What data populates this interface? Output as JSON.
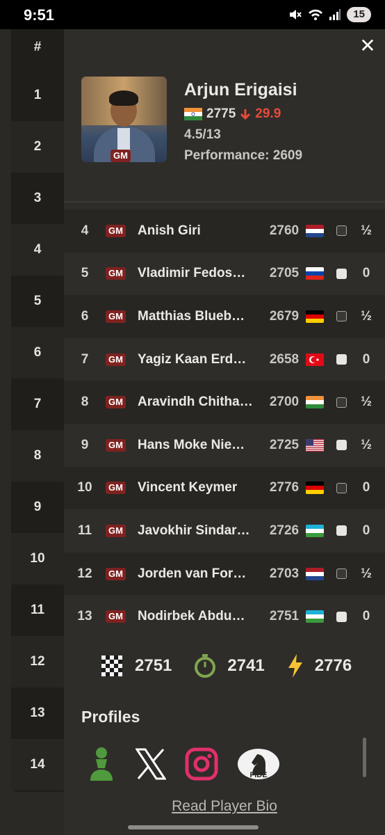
{
  "status_bar": {
    "time": "9:51",
    "battery": "15"
  },
  "rank_column": {
    "header": "#",
    "ranks": [
      "1",
      "2",
      "3",
      "4",
      "5",
      "6",
      "7",
      "8",
      "9",
      "10",
      "11",
      "12",
      "13",
      "14"
    ]
  },
  "player": {
    "name": "Arjun Erigaisi",
    "title": "GM",
    "flag": "india",
    "rating": "2775",
    "rating_change": "29.9",
    "score": "4.5/13",
    "performance": "Performance: 2609"
  },
  "games": [
    {
      "no": "4",
      "title": "GM",
      "name": "Anish Giri",
      "rating": "2760",
      "flag": "netherlands",
      "color": "black",
      "result": "½"
    },
    {
      "no": "5",
      "title": "GM",
      "name": "Vladimir Fedos…",
      "rating": "2705",
      "flag": "slovenia",
      "color": "white",
      "result": "0"
    },
    {
      "no": "6",
      "title": "GM",
      "name": "Matthias Blueb…",
      "rating": "2679",
      "flag": "germany",
      "color": "black",
      "result": "½"
    },
    {
      "no": "7",
      "title": "GM",
      "name": "Yagiz Kaan Erd…",
      "rating": "2658",
      "flag": "turkey",
      "color": "white",
      "result": "0"
    },
    {
      "no": "8",
      "title": "GM",
      "name": "Aravindh Chitha…",
      "rating": "2700",
      "flag": "india",
      "color": "black",
      "result": "½"
    },
    {
      "no": "9",
      "title": "GM",
      "name": "Hans Moke Nie…",
      "rating": "2725",
      "flag": "usa",
      "color": "white",
      "result": "½"
    },
    {
      "no": "10",
      "title": "GM",
      "name": "Vincent Keymer",
      "rating": "2776",
      "flag": "germany",
      "color": "black",
      "result": "0"
    },
    {
      "no": "11",
      "title": "GM",
      "name": "Javokhir Sindar…",
      "rating": "2726",
      "flag": "uzbekistan",
      "color": "white",
      "result": "0"
    },
    {
      "no": "12",
      "title": "GM",
      "name": "Jorden van For…",
      "rating": "2703",
      "flag": "netherlands",
      "color": "black",
      "result": "½"
    },
    {
      "no": "13",
      "title": "GM",
      "name": "Nodirbek Abdu…",
      "rating": "2751",
      "flag": "uzbekistan",
      "color": "white",
      "result": "0"
    }
  ],
  "ratings": {
    "classical": "2751",
    "rapid": "2741",
    "blitz": "2776"
  },
  "profiles": {
    "heading": "Profiles",
    "icons": [
      "chesscom-pawn-icon",
      "x-icon",
      "instagram-icon",
      "fide-icon"
    ],
    "fide_label": "FIDE"
  },
  "bio_link": "Read Player Bio",
  "colors": {
    "accent_red": "#e64a3c",
    "badge": "#7f2220",
    "rapid_green": "#7fa650",
    "blitz_yellow": "#f6c433"
  }
}
